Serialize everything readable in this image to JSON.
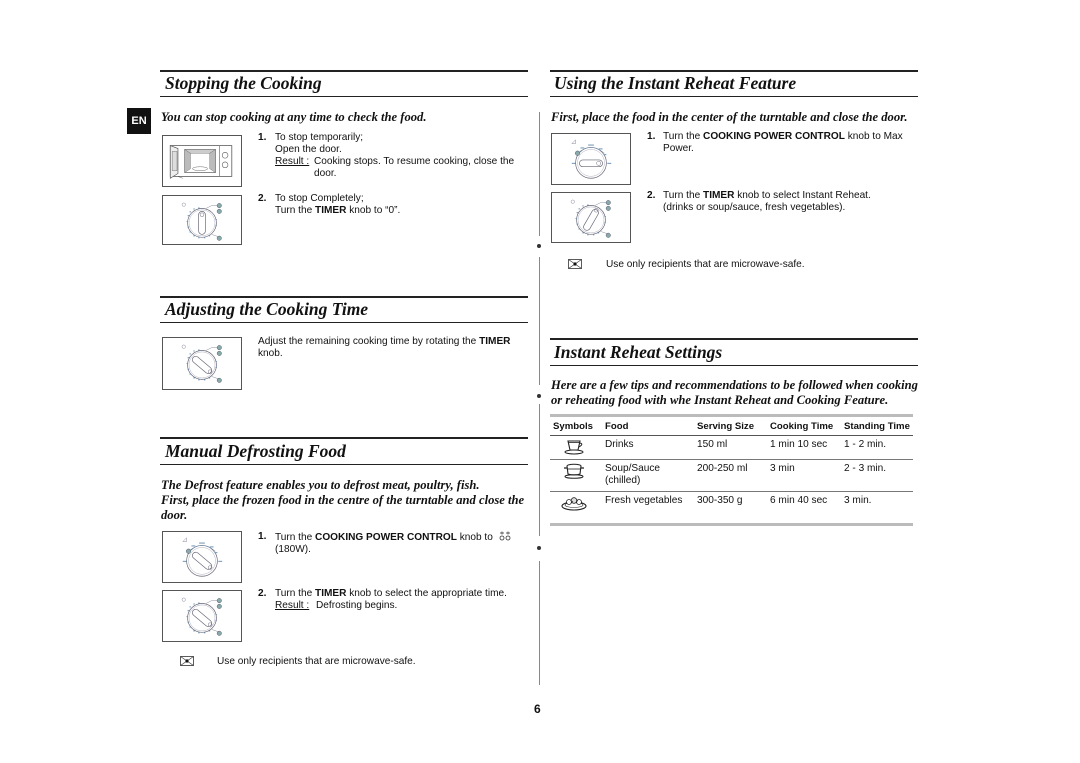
{
  "language_badge": "EN",
  "page_number": "6",
  "stopping": {
    "title": "Stopping the Cooking",
    "subtitle": "You can stop cooking at any time to check the food.",
    "steps": [
      {
        "num": "1.",
        "line1": "To stop temporarily;",
        "line2": "Open the door.",
        "result_label": "Result :",
        "result_text": "Cooking stops. To resume cooking, close the door."
      },
      {
        "num": "2.",
        "line1": "To stop Completely;",
        "line2_pre": "Turn the ",
        "line2_bold": "TIMER",
        "line2_post": " knob to “0”."
      }
    ]
  },
  "adjusting": {
    "title": "Adjusting the Cooking Time",
    "text_pre": "Adjust the remaining cooking time by rotating the ",
    "text_bold": "TIMER",
    "text_post": " knob."
  },
  "defrost": {
    "title": "Manual Defrosting Food",
    "subtitle_line1": "The Defrost feature enables you to defrost meat, poultry, fish.",
    "subtitle_line2": "First, place the frozen food in the centre of the turntable and close the door.",
    "steps": [
      {
        "num": "1.",
        "pre": "Turn the ",
        "bold": "COOKING POWER CONTROL",
        "post": " knob to",
        "icon": "defrost-icon",
        "line2": "(180W)."
      },
      {
        "num": "2.",
        "pre": "Turn the ",
        "bold": "TIMER",
        "post": " knob to select the appropriate time.",
        "result_label": "Result :",
        "result_text": "Defrosting begins."
      }
    ],
    "note": "Use only recipients that are microwave-safe."
  },
  "reheat_feature": {
    "title": "Using the Instant Reheat Feature",
    "subtitle": "First, place the food in the center of the turntable and close the door.",
    "steps": [
      {
        "num": "1.",
        "pre": "Turn the ",
        "bold": "COOKING POWER CONTROL",
        "post": " knob to Max Power."
      },
      {
        "num": "2.",
        "pre": "Turn the ",
        "bold": "TIMER",
        "post": " knob to select Instant Reheat.",
        "line2": "(drinks or soup/sauce, fresh vegetables)."
      }
    ],
    "note": "Use only recipients that are microwave-safe."
  },
  "reheat_settings": {
    "title": "Instant Reheat Settings",
    "subtitle": "Here are a few tips and recommendations to be followed when cooking or reheating food with whe Instant Reheat and Cooking Feature.",
    "columns": [
      "Symbols",
      "Food",
      "Serving Size",
      "Cooking Time",
      "Standing Time"
    ],
    "rows": [
      {
        "symbol": "cup-icon",
        "food": "Drinks",
        "food2": "",
        "serving": "150 ml",
        "cooking": "1 min 10 sec",
        "standing": "1 - 2 min."
      },
      {
        "symbol": "soup-pot-icon",
        "food": "Soup/Sauce",
        "food2": "(chilled)",
        "serving": "200-250 ml",
        "cooking": "3 min",
        "standing": "2 - 3 min."
      },
      {
        "symbol": "vegetables-plate-icon",
        "food": "Fresh vegetables",
        "food2": "",
        "serving": "300-350 g",
        "cooking": "6 min 40 sec",
        "standing": "3 min."
      }
    ]
  }
}
